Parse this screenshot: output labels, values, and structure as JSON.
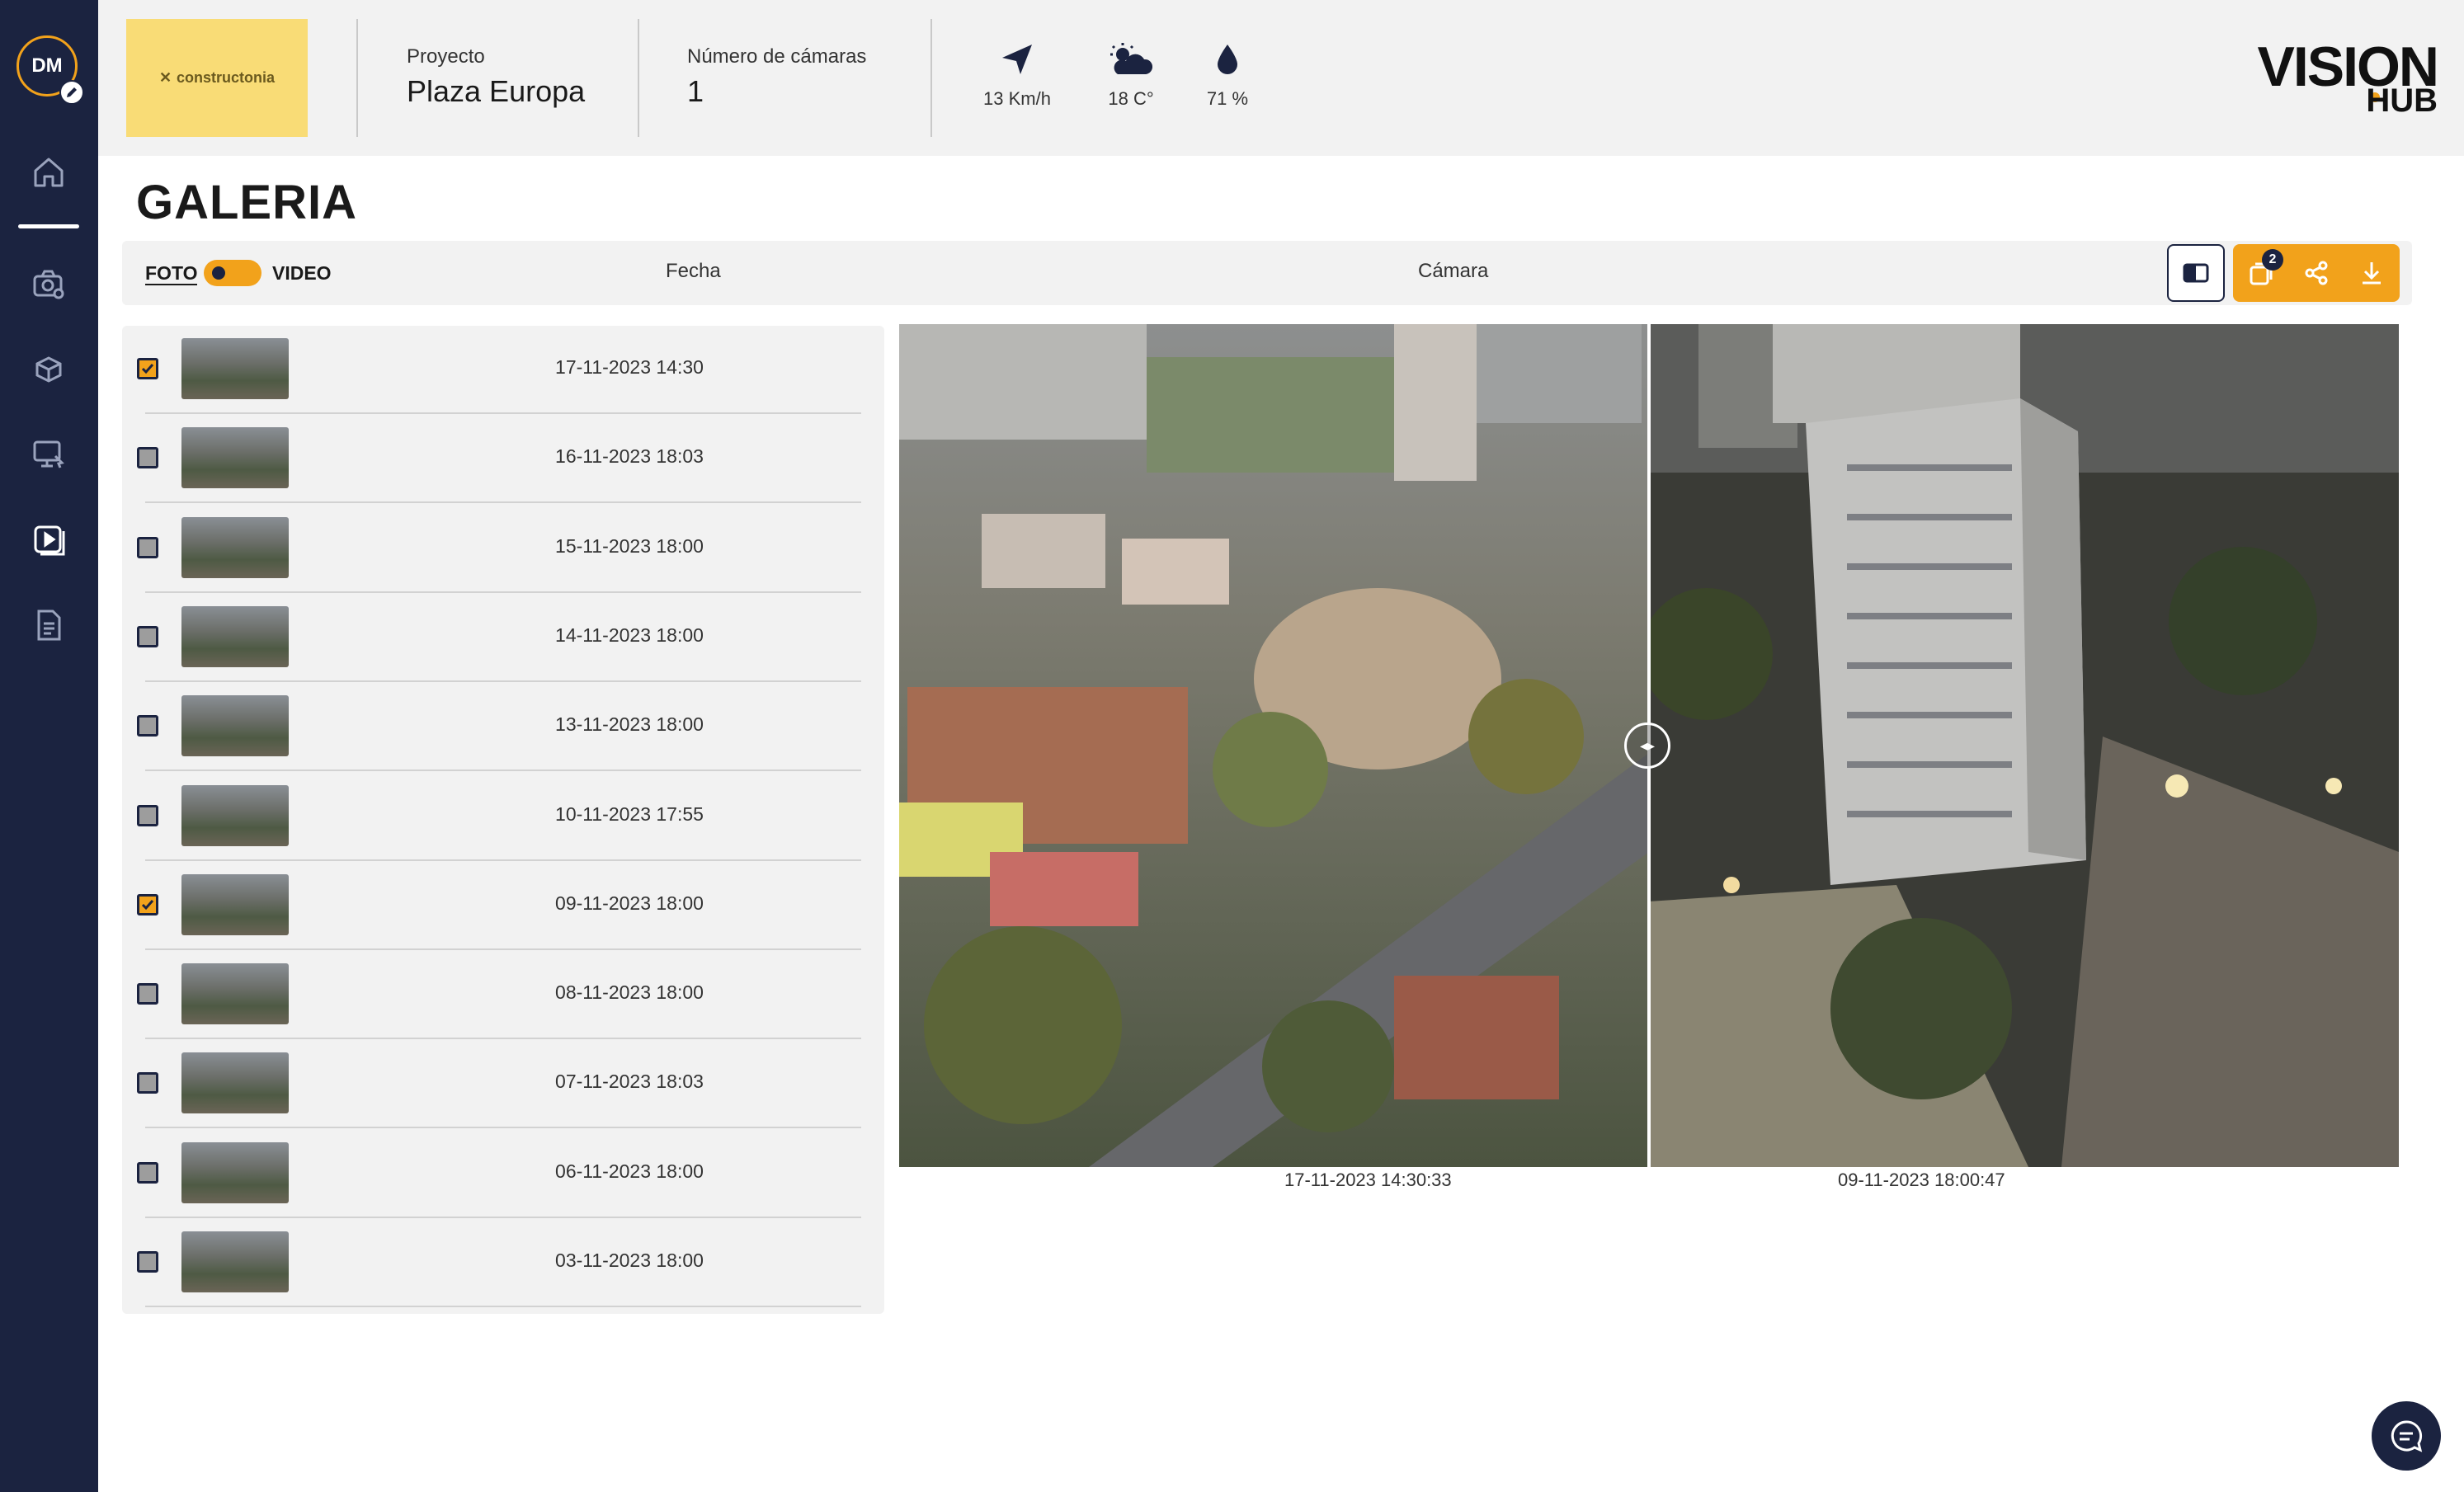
{
  "sidebar": {
    "avatar_initials": "DM",
    "items": [
      {
        "icon": "home-icon"
      },
      {
        "icon": "camera-settings-icon"
      },
      {
        "icon": "boxes-icon"
      },
      {
        "icon": "monitor-icon"
      },
      {
        "icon": "gallery-play-icon"
      },
      {
        "icon": "document-icon"
      }
    ]
  },
  "header": {
    "company_logo_text": "constructonia",
    "project_label": "Proyecto",
    "project_value": "Plaza Europa",
    "cameras_label": "Número de cámaras",
    "cameras_value": "1",
    "wind": "13 Km/h",
    "temperature": "18 C°",
    "humidity": "71 %",
    "brand_top": "VISION",
    "brand_bottom": "HUB"
  },
  "page": {
    "title": "GALERIA"
  },
  "filters": {
    "foto": "FOTO",
    "video": "VIDEO",
    "fecha": "Fecha",
    "camara": "Cámara",
    "selected_count": "2"
  },
  "photos": [
    {
      "date": "17-11-2023 14:30",
      "checked": true
    },
    {
      "date": "16-11-2023 18:03",
      "checked": false
    },
    {
      "date": "15-11-2023 18:00",
      "checked": false
    },
    {
      "date": "14-11-2023 18:00",
      "checked": false
    },
    {
      "date": "13-11-2023 18:00",
      "checked": false
    },
    {
      "date": "10-11-2023 17:55",
      "checked": false
    },
    {
      "date": "09-11-2023 18:00",
      "checked": true
    },
    {
      "date": "08-11-2023 18:00",
      "checked": false
    },
    {
      "date": "07-11-2023 18:03",
      "checked": false
    },
    {
      "date": "06-11-2023 18:00",
      "checked": false
    },
    {
      "date": "03-11-2023 18:00",
      "checked": false
    }
  ],
  "compare": {
    "left_caption": "17-11-2023 14:30:33",
    "right_caption": "09-11-2023 18:00:47",
    "divider_position": 0.5
  },
  "colors": {
    "accent": "#f2a21b",
    "sidebar": "#1b2340"
  }
}
